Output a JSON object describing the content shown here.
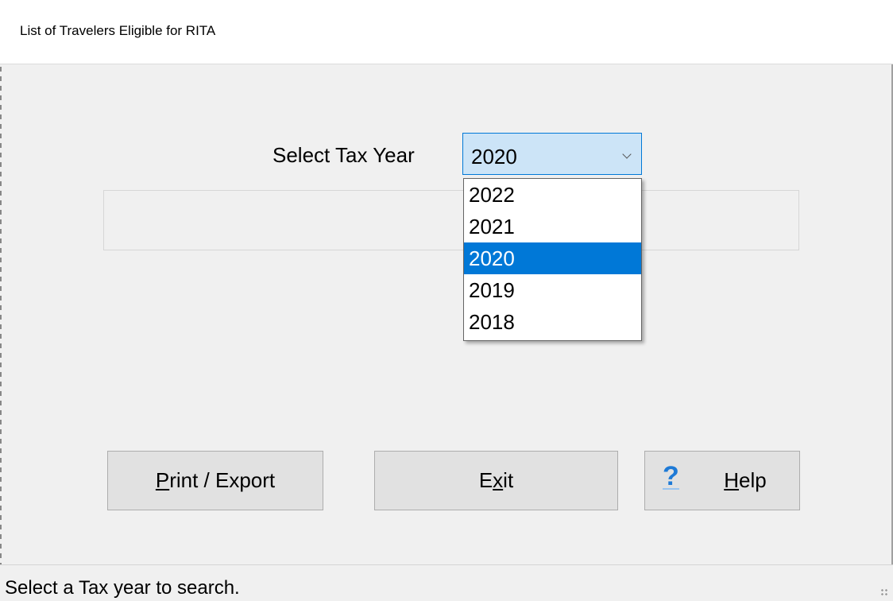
{
  "window": {
    "title": "List of Travelers Eligible for RITA"
  },
  "form": {
    "tax_year_label": "Select Tax Year",
    "tax_year_value": "2020",
    "tax_year_options": [
      "2022",
      "2021",
      "2020",
      "2019",
      "2018"
    ],
    "selected_index": 2
  },
  "buttons": {
    "print_export": {
      "underlined": "P",
      "rest": "rint / Export"
    },
    "exit": {
      "pre": "E",
      "underlined": "x",
      "rest": "it"
    },
    "help": {
      "underlined": "H",
      "rest": "elp",
      "icon": "question-mark-icon",
      "icon_char": "?"
    }
  },
  "status": {
    "text": "Select a Tax year to search."
  },
  "colors": {
    "selection": "#0078d7",
    "combo_bg": "#cce4f7",
    "help_icon": "#1e7ad6"
  }
}
